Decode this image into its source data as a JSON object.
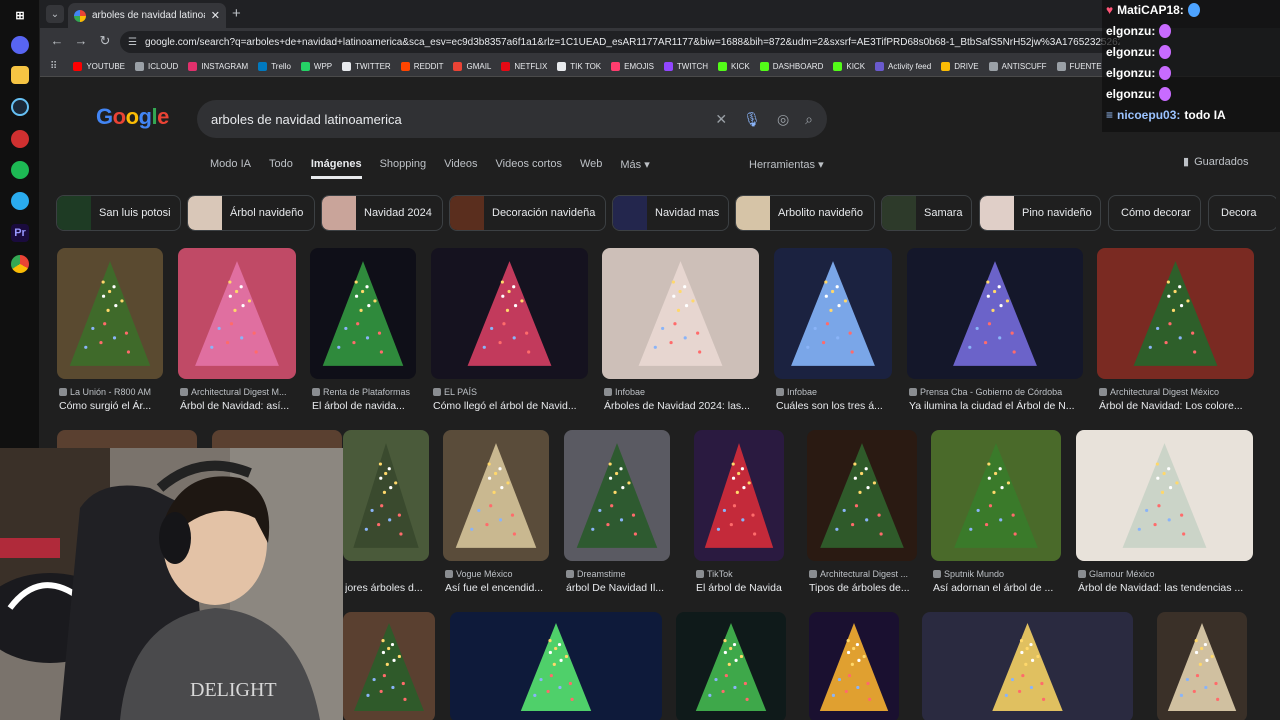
{
  "taskbar": {
    "icons": [
      "windows-icon",
      "discord-icon",
      "files-icon",
      "steam-icon",
      "app-icon",
      "spotify-icon",
      "telegram-icon",
      "premiere-icon",
      "chrome-icon"
    ]
  },
  "browser": {
    "tab_title": "arboles de navidad latinoamerica",
    "url": "google.com/search?q=arboles+de+navidad+latinoamerica&sca_esv=ec9d3b8357a6f1a1&rlz=1C1UEAD_esAR1177AR1177&biw=1688&bih=872&udm=2&sxsrf=AE3TifPRD68s0b68-1_BtbSafS5NrH52jw%3A1765232526235&ei=j...",
    "bookmarks": [
      {
        "label": "YOUTUBE",
        "color": "#ff0000"
      },
      {
        "label": "ICLOUD",
        "color": "#9aa0a6"
      },
      {
        "label": "INSTAGRAM",
        "color": "#e1306c"
      },
      {
        "label": "Trello",
        "color": "#0079bf"
      },
      {
        "label": "WPP",
        "color": "#25d366"
      },
      {
        "label": "TWITTER",
        "color": "#e8eaed"
      },
      {
        "label": "REDDIT",
        "color": "#ff4500"
      },
      {
        "label": "GMAIL",
        "color": "#ea4335"
      },
      {
        "label": "NETFLIX",
        "color": "#e50914"
      },
      {
        "label": "TIK TOK",
        "color": "#e8eaed"
      },
      {
        "label": "EMOJIS",
        "color": "#ff3d6e"
      },
      {
        "label": "TWITCH",
        "color": "#9146ff"
      },
      {
        "label": "KICK",
        "color": "#53fc18"
      },
      {
        "label": "DASHBOARD",
        "color": "#53fc18"
      },
      {
        "label": "KICK",
        "color": "#53fc18"
      },
      {
        "label": "Activity feed",
        "color": "#6a5acd"
      },
      {
        "label": "DRIVE",
        "color": "#fbbc05"
      },
      {
        "label": "ANTISCUFF",
        "color": "#9aa0a6"
      },
      {
        "label": "FUENTE",
        "color": "#9aa0a6"
      }
    ]
  },
  "google": {
    "logo": "Google",
    "query": "arboles de navidad latinoamerica",
    "tabs": [
      "Modo IA",
      "Todo",
      "Imágenes",
      "Shopping",
      "Videos",
      "Videos cortos",
      "Web",
      "Más ▾"
    ],
    "tools": "Herramientas ▾",
    "saved": "Guardados",
    "chips": [
      {
        "label": "San luis potosi",
        "color": "#1e3b24"
      },
      {
        "label": "Árbol navideño",
        "color": "#d9c7b8"
      },
      {
        "label": "Navidad 2024",
        "color": "#c9a49a"
      },
      {
        "label": "Decoración navideña",
        "color": "#5a2e1e"
      },
      {
        "label": "Navidad mas",
        "color": "#23264d"
      },
      {
        "label": "Arbolito navideño",
        "color": "#d6c4a7"
      },
      {
        "label": "Samara",
        "color": "#2d3a2a"
      },
      {
        "label": "Pino navideño",
        "color": "#e0cfc8"
      },
      {
        "label": "Cómo decorar",
        "color": ""
      },
      {
        "label": "Decora",
        "color": ""
      }
    ],
    "row1": [
      {
        "source": "La Unión - R800 AM",
        "caption": "Cómo surgió el Ár...",
        "bg": "#5a4a30",
        "tree": "#3f6a2a"
      },
      {
        "source": "Architectural Digest M...",
        "caption": "Árbol de Navidad: así...",
        "bg": "#c04a66",
        "tree": "#e06fa0"
      },
      {
        "source": "Renta de Plataformas",
        "caption": "El árbol de navida...",
        "bg": "#0f0f18",
        "tree": "#2f8a3c"
      },
      {
        "source": "EL PAÍS",
        "caption": "Cómo llegó el árbol de Navid...",
        "bg": "#15121f",
        "tree": "#c23a5c"
      },
      {
        "source": "Infobae",
        "caption": "Árboles de Navidad 2024: las...",
        "bg": "#cdbfb8",
        "tree": "#e7d6d0"
      },
      {
        "source": "Infobae",
        "caption": "Cuáles son los tres á...",
        "bg": "#1b2240",
        "tree": "#7aa6e8"
      },
      {
        "source": "Prensa Cba - Gobierno de Córdoba",
        "caption": "Ya ilumina la ciudad el Árbol de N...",
        "bg": "#14172a",
        "tree": "#6b63c9"
      },
      {
        "source": "Architectural Digest México",
        "caption": "Árbol de Navidad: Los colore...",
        "bg": "#7a2a22",
        "tree": "#2e5f2a"
      }
    ],
    "row2": [
      {
        "source": "",
        "caption": "jores árboles d...",
        "bg": "#4a5a3a",
        "tree": "#3a4a2e"
      },
      {
        "source": "Vogue México",
        "caption": "Así fue el encendid...",
        "bg": "#5a4c3a",
        "tree": "#c9b890"
      },
      {
        "source": "Dreamstime",
        "caption": "árbol De Navidad Il...",
        "bg": "#5a5a62",
        "tree": "#2e5a30"
      },
      {
        "source": "TikTok",
        "caption": "El árbol de Navida...",
        "bg": "#2a1a40",
        "tree": "#c42a3a"
      },
      {
        "source": "Architectural Digest ...",
        "caption": "Tipos de árboles de...",
        "bg": "#2a1a12",
        "tree": "#2f5a2a"
      },
      {
        "source": "Sputnik Mundo",
        "caption": "Así adornan el árbol de ...",
        "bg": "#4a6a2a",
        "tree": "#3a7a2a"
      },
      {
        "source": "Glamour México",
        "caption": "Árbol de Navidad: las tendencias ...",
        "bg": "#e8e2da",
        "tree": "#cbd4c8"
      }
    ],
    "row3": [
      {
        "bg": "#5a4030",
        "tree": "#2f5a2a"
      },
      {
        "bg": "#0e1a3a",
        "tree": "#4fd06a"
      },
      {
        "bg": "#0f1a1a",
        "tree": "#3ea84a"
      },
      {
        "bg": "#1a1030",
        "tree": "#e0a030"
      },
      {
        "bg": "#2a2a40",
        "tree": "#e0c060"
      },
      {
        "bg": "#3a3028",
        "tree": "#d0c0a0"
      }
    ]
  },
  "chat": {
    "lines": [
      {
        "user": "MatiCAP18:",
        "msg": "",
        "color": "white"
      },
      {
        "user": "elgonzu:",
        "msg": "",
        "color": "white"
      },
      {
        "user": "elgonzu:",
        "msg": "",
        "color": "white"
      },
      {
        "user": "elgonzu:",
        "msg": "",
        "color": "white"
      },
      {
        "user": "elgonzu:",
        "msg": "",
        "color": "white"
      },
      {
        "user": "nicoepu03:",
        "msg": "todo IA",
        "color": "blue"
      }
    ]
  }
}
